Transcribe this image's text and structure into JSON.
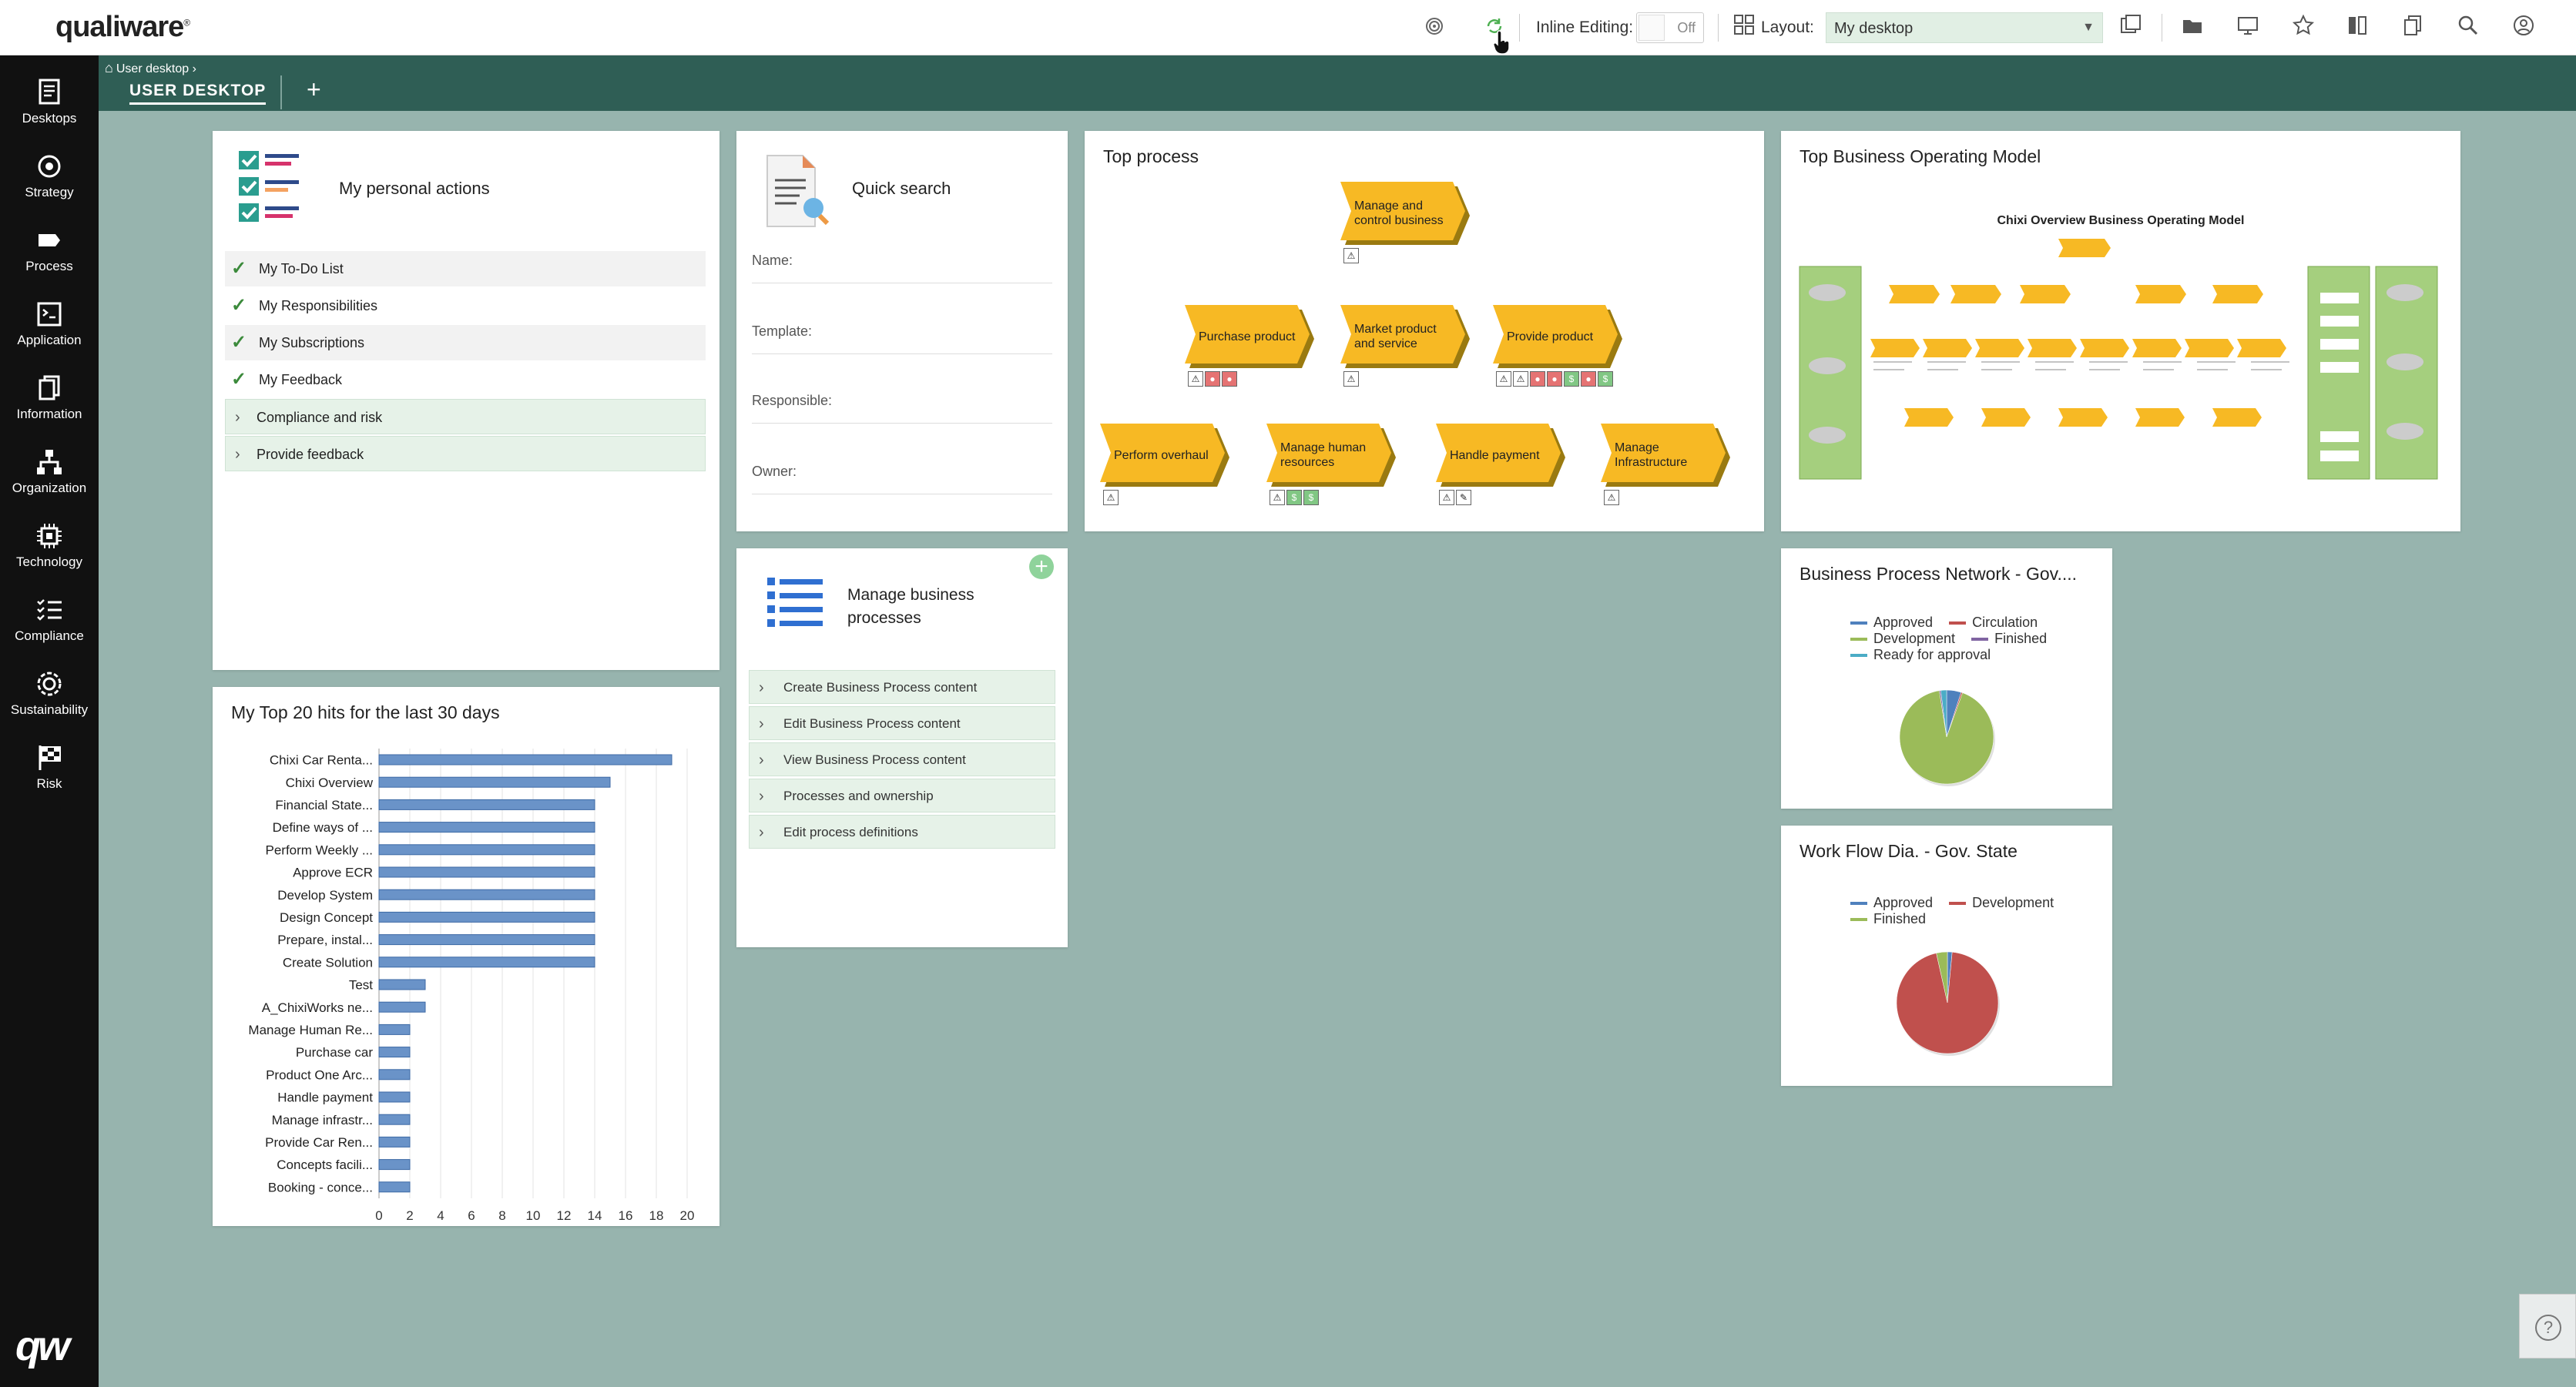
{
  "app": {
    "logo": "qualiware"
  },
  "toolbar": {
    "inline_editing_label": "Inline Editing:",
    "inline_editing_value": "Off",
    "layout_label": "Layout:",
    "layout_value": "My desktop"
  },
  "sidebar": {
    "items": [
      {
        "label": "Desktops",
        "icon": "desktops-icon"
      },
      {
        "label": "Strategy",
        "icon": "strategy-icon"
      },
      {
        "label": "Process",
        "icon": "process-icon"
      },
      {
        "label": "Application",
        "icon": "application-icon"
      },
      {
        "label": "Information",
        "icon": "information-icon"
      },
      {
        "label": "Organization",
        "icon": "organization-icon"
      },
      {
        "label": "Technology",
        "icon": "technology-icon"
      },
      {
        "label": "Compliance",
        "icon": "compliance-icon"
      },
      {
        "label": "Sustainability",
        "icon": "sustainability-icon"
      },
      {
        "label": "Risk",
        "icon": "risk-icon"
      }
    ]
  },
  "tabs": {
    "breadcrumb": "User desktop",
    "active": "USER DESKTOP",
    "add": "+"
  },
  "personal_actions": {
    "title": "My personal actions",
    "items": [
      "My To-Do List",
      "My Responsibilities",
      "My Subscriptions",
      "My Feedback"
    ],
    "groups": [
      "Compliance and risk",
      "Provide feedback"
    ]
  },
  "quick_search": {
    "title": "Quick search",
    "fields": [
      "Name:",
      "Template:",
      "Responsible:",
      "Owner:"
    ]
  },
  "manage_processes": {
    "title_line1": "Manage business",
    "title_line2": "processes",
    "add": "+",
    "items": [
      "Create Business Process content",
      "Edit Business Process content",
      "View Business Process content",
      "Processes and ownership",
      "Edit process definitions"
    ]
  },
  "top_process": {
    "title": "Top process",
    "shapes": [
      {
        "line1": "Manage and",
        "line2": "control business"
      },
      {
        "line1": "Purchase product",
        "line2": ""
      },
      {
        "line1": "Market product",
        "line2": "and service"
      },
      {
        "line1": "Provide product",
        "line2": ""
      },
      {
        "line1": "Perform overhaul",
        "line2": ""
      },
      {
        "line1": "Manage human",
        "line2": "resources"
      },
      {
        "line1": "Handle payment",
        "line2": ""
      },
      {
        "line1": "Manage",
        "line2": "Infrastructure"
      }
    ]
  },
  "top_bom": {
    "title": "Top Business Operating Model",
    "diagram_title": "Chixi Overview Business Operating Model"
  },
  "bpn": {
    "title": "Business Process Network - Gov....",
    "legend": [
      "Approved",
      "Circulation",
      "Development",
      "Finished",
      "Ready for approval"
    ]
  },
  "wfd": {
    "title": "Work Flow Dia. - Gov. State",
    "legend": [
      "Approved",
      "Development",
      "Finished"
    ]
  },
  "colors": {
    "approved": "#4f81bd",
    "circulation": "#c0504d",
    "development": "#9bbb59",
    "finished": "#8064a2",
    "ready": "#4bacc6",
    "process_fill": "#f7b924",
    "bar": "#6a93c8"
  },
  "chart_data": [
    {
      "type": "bar",
      "orientation": "horizontal",
      "title": "My Top 20 hits for the last 30 days",
      "categories": [
        "Chixi Car Renta...",
        "Chixi Overview",
        "Financial State...",
        "Define ways of ...",
        "Perform Weekly ...",
        "Approve ECR",
        "Develop System",
        "Design Concept",
        "Prepare, instal...",
        "Create Solution",
        "Test",
        "A_ChixiWorks ne...",
        "Manage Human Re...",
        "Purchase car",
        "Product One Arc...",
        "Handle payment",
        "Manage infrastr...",
        "Provide Car Ren...",
        "Concepts facili...",
        "Booking - conce..."
      ],
      "values": [
        19,
        15,
        14,
        14,
        14,
        14,
        14,
        14,
        14,
        14,
        3,
        3,
        2,
        2,
        2,
        2,
        2,
        2,
        2,
        2
      ],
      "xlim": [
        0,
        20
      ],
      "xticks": [
        0,
        2,
        4,
        6,
        8,
        10,
        12,
        14,
        16,
        18,
        20
      ],
      "grid": true
    },
    {
      "type": "pie",
      "title": "Business Process Network - Gov....",
      "labels": [
        "Approved",
        "Circulation",
        "Development",
        "Finished",
        "Ready for approval"
      ],
      "values": [
        5,
        0.5,
        92,
        0.5,
        2
      ]
    },
    {
      "type": "pie",
      "title": "Work Flow Dia. - Gov. State",
      "labels": [
        "Approved",
        "Development",
        "Finished"
      ],
      "values": [
        1.5,
        95,
        3.5
      ]
    }
  ]
}
